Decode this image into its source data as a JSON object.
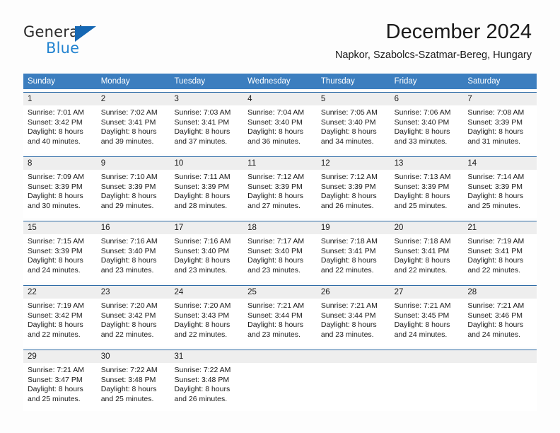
{
  "brand": {
    "name_part1": "General",
    "name_part2": "Blue",
    "logo_icon": "triangle-flag-icon"
  },
  "header": {
    "title": "December 2024",
    "subtitle": "Napkor, Szabolcs-Szatmar-Bereg, Hungary"
  },
  "colors": {
    "header_blue": "#3c7ebf",
    "row_divider_blue": "#2f6ca6",
    "daynum_band_gray": "#eeeeee",
    "brand_blue": "#2283d0",
    "logo_blue": "#1567b3",
    "text": "#1a1a1a"
  },
  "weekdays": [
    "Sunday",
    "Monday",
    "Tuesday",
    "Wednesday",
    "Thursday",
    "Friday",
    "Saturday"
  ],
  "weeks": [
    [
      {
        "day": "1",
        "sunrise": "Sunrise: 7:01 AM",
        "sunset": "Sunset: 3:42 PM",
        "daylight1": "Daylight: 8 hours",
        "daylight2": "and 40 minutes."
      },
      {
        "day": "2",
        "sunrise": "Sunrise: 7:02 AM",
        "sunset": "Sunset: 3:41 PM",
        "daylight1": "Daylight: 8 hours",
        "daylight2": "and 39 minutes."
      },
      {
        "day": "3",
        "sunrise": "Sunrise: 7:03 AM",
        "sunset": "Sunset: 3:41 PM",
        "daylight1": "Daylight: 8 hours",
        "daylight2": "and 37 minutes."
      },
      {
        "day": "4",
        "sunrise": "Sunrise: 7:04 AM",
        "sunset": "Sunset: 3:40 PM",
        "daylight1": "Daylight: 8 hours",
        "daylight2": "and 36 minutes."
      },
      {
        "day": "5",
        "sunrise": "Sunrise: 7:05 AM",
        "sunset": "Sunset: 3:40 PM",
        "daylight1": "Daylight: 8 hours",
        "daylight2": "and 34 minutes."
      },
      {
        "day": "6",
        "sunrise": "Sunrise: 7:06 AM",
        "sunset": "Sunset: 3:40 PM",
        "daylight1": "Daylight: 8 hours",
        "daylight2": "and 33 minutes."
      },
      {
        "day": "7",
        "sunrise": "Sunrise: 7:08 AM",
        "sunset": "Sunset: 3:39 PM",
        "daylight1": "Daylight: 8 hours",
        "daylight2": "and 31 minutes."
      }
    ],
    [
      {
        "day": "8",
        "sunrise": "Sunrise: 7:09 AM",
        "sunset": "Sunset: 3:39 PM",
        "daylight1": "Daylight: 8 hours",
        "daylight2": "and 30 minutes."
      },
      {
        "day": "9",
        "sunrise": "Sunrise: 7:10 AM",
        "sunset": "Sunset: 3:39 PM",
        "daylight1": "Daylight: 8 hours",
        "daylight2": "and 29 minutes."
      },
      {
        "day": "10",
        "sunrise": "Sunrise: 7:11 AM",
        "sunset": "Sunset: 3:39 PM",
        "daylight1": "Daylight: 8 hours",
        "daylight2": "and 28 minutes."
      },
      {
        "day": "11",
        "sunrise": "Sunrise: 7:12 AM",
        "sunset": "Sunset: 3:39 PM",
        "daylight1": "Daylight: 8 hours",
        "daylight2": "and 27 minutes."
      },
      {
        "day": "12",
        "sunrise": "Sunrise: 7:12 AM",
        "sunset": "Sunset: 3:39 PM",
        "daylight1": "Daylight: 8 hours",
        "daylight2": "and 26 minutes."
      },
      {
        "day": "13",
        "sunrise": "Sunrise: 7:13 AM",
        "sunset": "Sunset: 3:39 PM",
        "daylight1": "Daylight: 8 hours",
        "daylight2": "and 25 minutes."
      },
      {
        "day": "14",
        "sunrise": "Sunrise: 7:14 AM",
        "sunset": "Sunset: 3:39 PM",
        "daylight1": "Daylight: 8 hours",
        "daylight2": "and 25 minutes."
      }
    ],
    [
      {
        "day": "15",
        "sunrise": "Sunrise: 7:15 AM",
        "sunset": "Sunset: 3:39 PM",
        "daylight1": "Daylight: 8 hours",
        "daylight2": "and 24 minutes."
      },
      {
        "day": "16",
        "sunrise": "Sunrise: 7:16 AM",
        "sunset": "Sunset: 3:40 PM",
        "daylight1": "Daylight: 8 hours",
        "daylight2": "and 23 minutes."
      },
      {
        "day": "17",
        "sunrise": "Sunrise: 7:16 AM",
        "sunset": "Sunset: 3:40 PM",
        "daylight1": "Daylight: 8 hours",
        "daylight2": "and 23 minutes."
      },
      {
        "day": "18",
        "sunrise": "Sunrise: 7:17 AM",
        "sunset": "Sunset: 3:40 PM",
        "daylight1": "Daylight: 8 hours",
        "daylight2": "and 23 minutes."
      },
      {
        "day": "19",
        "sunrise": "Sunrise: 7:18 AM",
        "sunset": "Sunset: 3:41 PM",
        "daylight1": "Daylight: 8 hours",
        "daylight2": "and 22 minutes."
      },
      {
        "day": "20",
        "sunrise": "Sunrise: 7:18 AM",
        "sunset": "Sunset: 3:41 PM",
        "daylight1": "Daylight: 8 hours",
        "daylight2": "and 22 minutes."
      },
      {
        "day": "21",
        "sunrise": "Sunrise: 7:19 AM",
        "sunset": "Sunset: 3:41 PM",
        "daylight1": "Daylight: 8 hours",
        "daylight2": "and 22 minutes."
      }
    ],
    [
      {
        "day": "22",
        "sunrise": "Sunrise: 7:19 AM",
        "sunset": "Sunset: 3:42 PM",
        "daylight1": "Daylight: 8 hours",
        "daylight2": "and 22 minutes."
      },
      {
        "day": "23",
        "sunrise": "Sunrise: 7:20 AM",
        "sunset": "Sunset: 3:42 PM",
        "daylight1": "Daylight: 8 hours",
        "daylight2": "and 22 minutes."
      },
      {
        "day": "24",
        "sunrise": "Sunrise: 7:20 AM",
        "sunset": "Sunset: 3:43 PM",
        "daylight1": "Daylight: 8 hours",
        "daylight2": "and 22 minutes."
      },
      {
        "day": "25",
        "sunrise": "Sunrise: 7:21 AM",
        "sunset": "Sunset: 3:44 PM",
        "daylight1": "Daylight: 8 hours",
        "daylight2": "and 23 minutes."
      },
      {
        "day": "26",
        "sunrise": "Sunrise: 7:21 AM",
        "sunset": "Sunset: 3:44 PM",
        "daylight1": "Daylight: 8 hours",
        "daylight2": "and 23 minutes."
      },
      {
        "day": "27",
        "sunrise": "Sunrise: 7:21 AM",
        "sunset": "Sunset: 3:45 PM",
        "daylight1": "Daylight: 8 hours",
        "daylight2": "and 24 minutes."
      },
      {
        "day": "28",
        "sunrise": "Sunrise: 7:21 AM",
        "sunset": "Sunset: 3:46 PM",
        "daylight1": "Daylight: 8 hours",
        "daylight2": "and 24 minutes."
      }
    ],
    [
      {
        "day": "29",
        "sunrise": "Sunrise: 7:21 AM",
        "sunset": "Sunset: 3:47 PM",
        "daylight1": "Daylight: 8 hours",
        "daylight2": "and 25 minutes."
      },
      {
        "day": "30",
        "sunrise": "Sunrise: 7:22 AM",
        "sunset": "Sunset: 3:48 PM",
        "daylight1": "Daylight: 8 hours",
        "daylight2": "and 25 minutes."
      },
      {
        "day": "31",
        "sunrise": "Sunrise: 7:22 AM",
        "sunset": "Sunset: 3:48 PM",
        "daylight1": "Daylight: 8 hours",
        "daylight2": "and 26 minutes."
      },
      {
        "day": "",
        "sunrise": "",
        "sunset": "",
        "daylight1": "",
        "daylight2": ""
      },
      {
        "day": "",
        "sunrise": "",
        "sunset": "",
        "daylight1": "",
        "daylight2": ""
      },
      {
        "day": "",
        "sunrise": "",
        "sunset": "",
        "daylight1": "",
        "daylight2": ""
      },
      {
        "day": "",
        "sunrise": "",
        "sunset": "",
        "daylight1": "",
        "daylight2": ""
      }
    ]
  ]
}
